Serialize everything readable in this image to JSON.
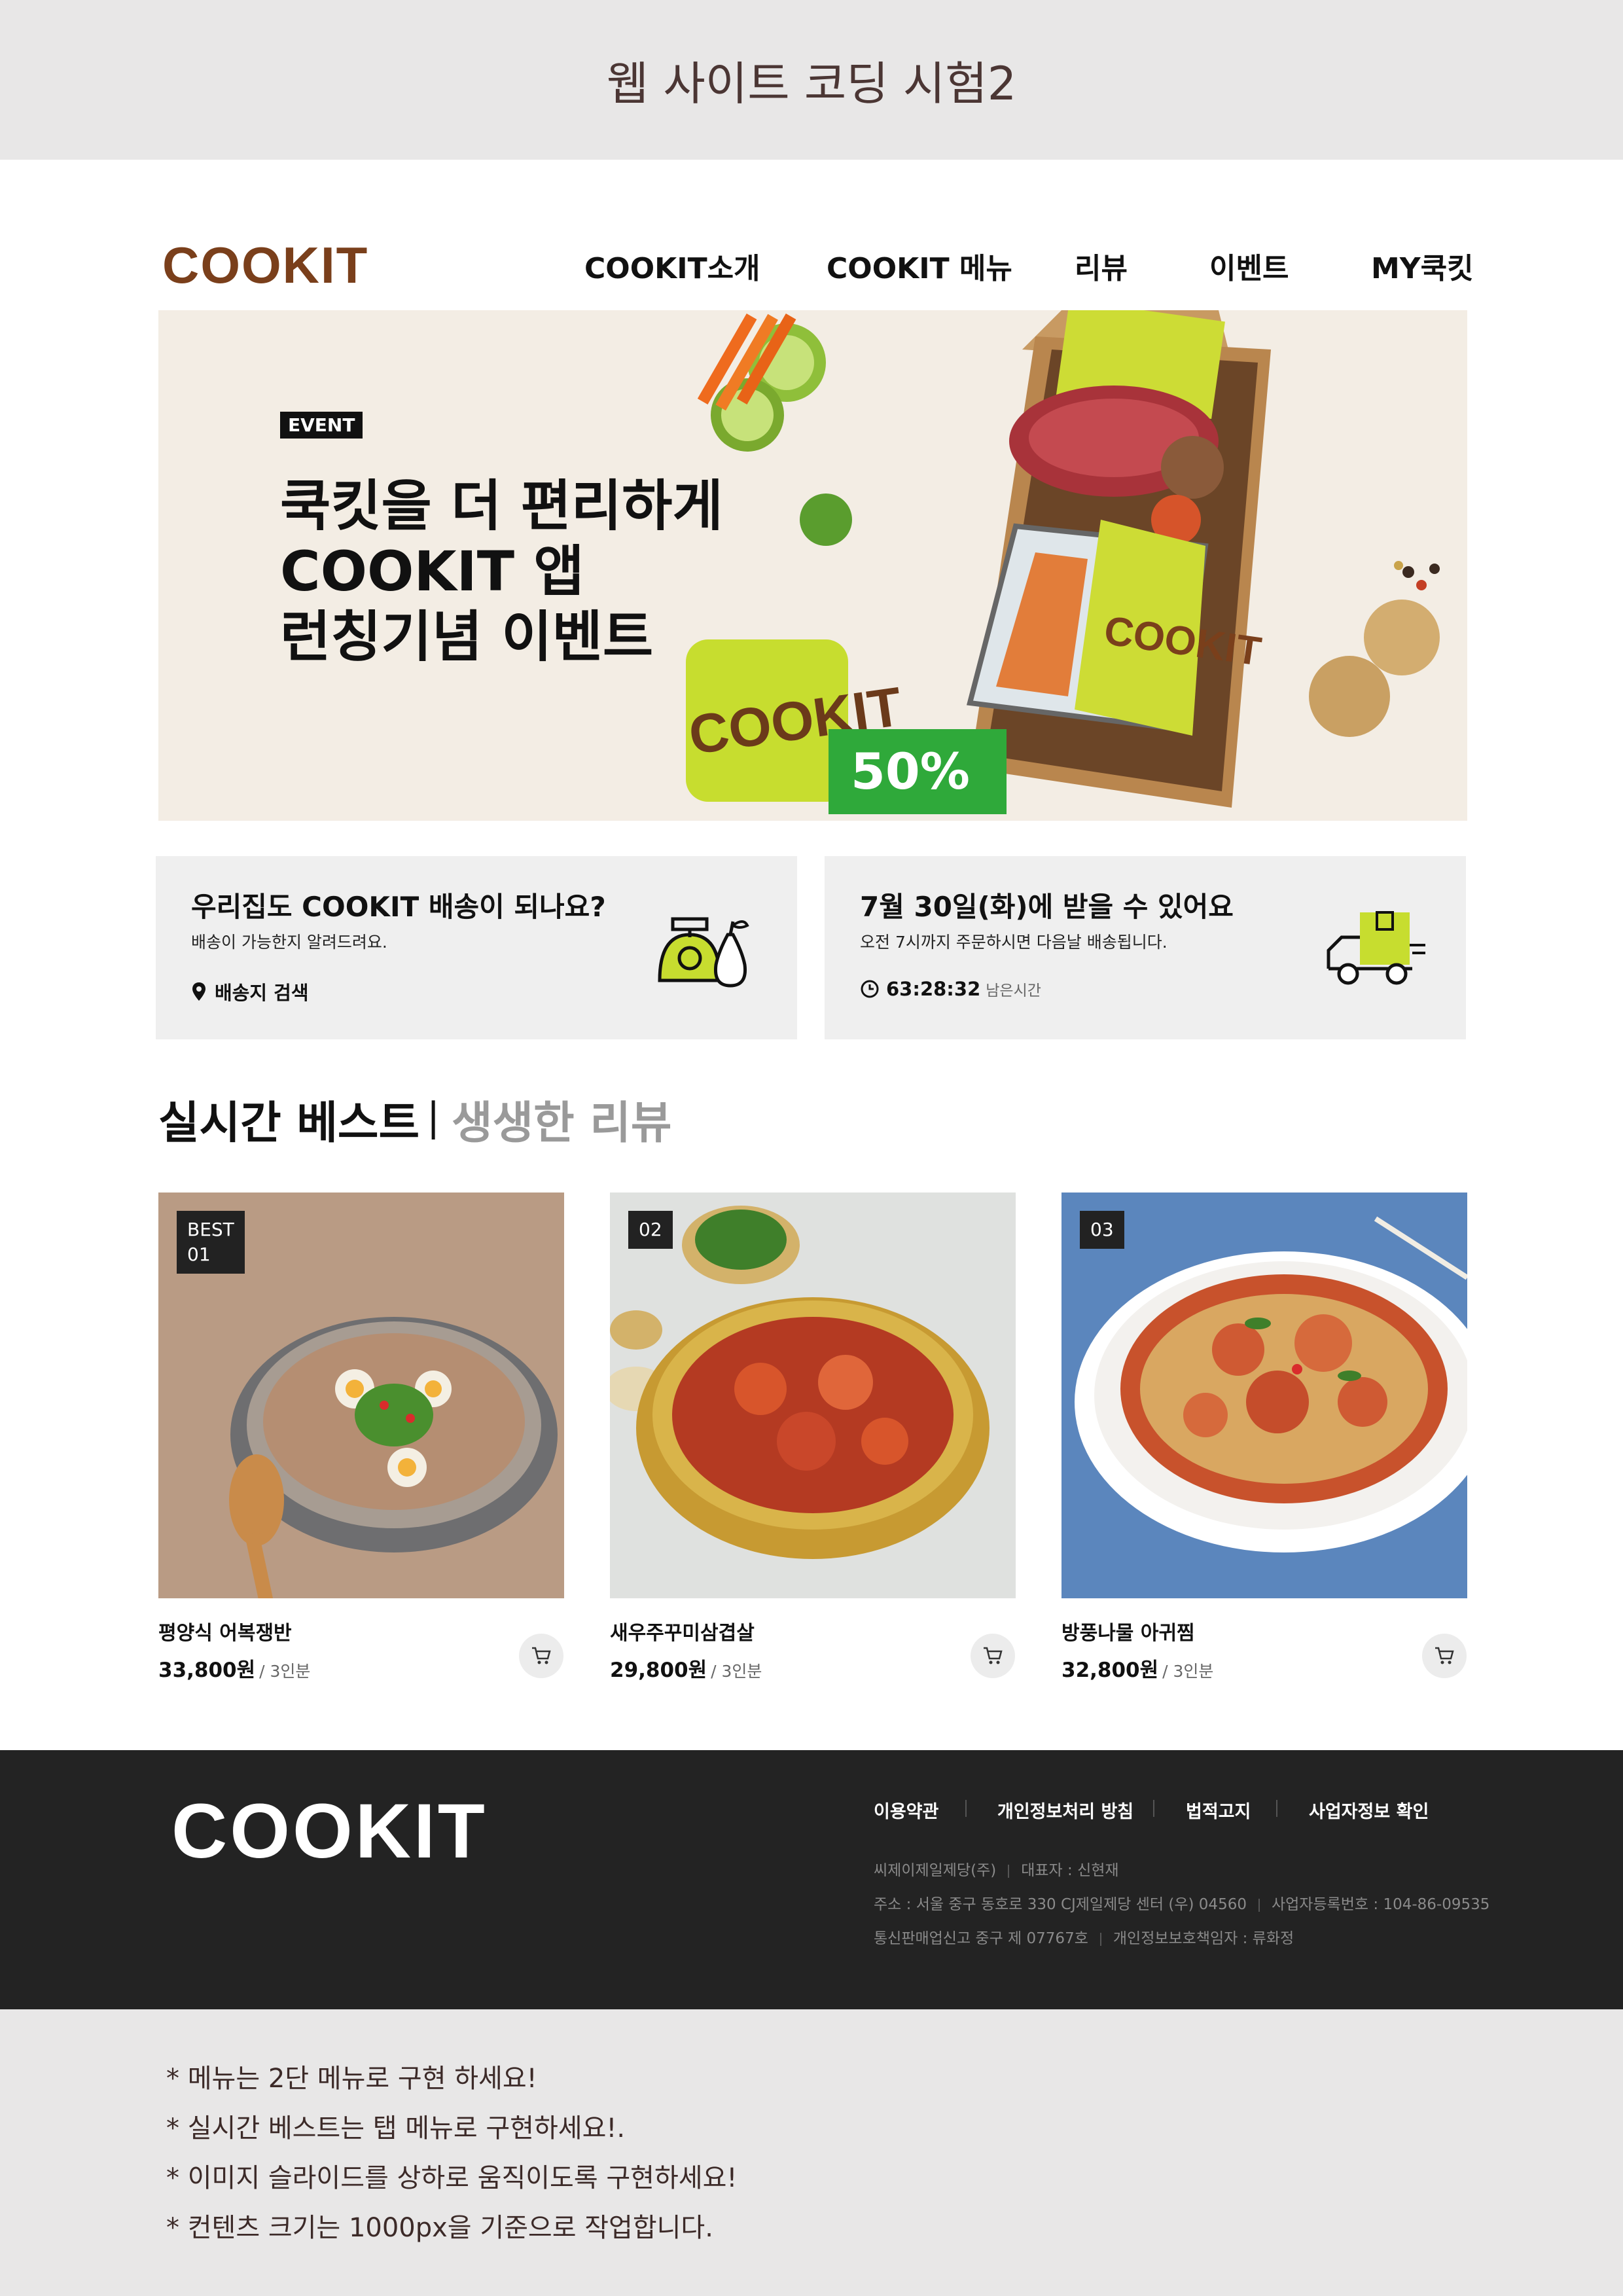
{
  "top_banner": {
    "title": "웹 사이트 코딩 시험2"
  },
  "header": {
    "logo": "COOKIT",
    "nav": [
      "COOKIT소개",
      "COOKIT 메뉴",
      "리뷰",
      "이벤트",
      "MY쿡킷"
    ]
  },
  "hero": {
    "badge": "EVENT",
    "lines": [
      "쿡킷을 더 편리하게",
      "COOKIT 앱",
      "런칭기념 이벤트"
    ],
    "app_logo": "COOKIT",
    "discount": "50%",
    "box_label": "COOKIT"
  },
  "info_cards": [
    {
      "title": "우리집도 COOKIT 배송이 되나요?",
      "subtitle": "배송이 가능한지 알려드려요.",
      "action": "배송지 검색"
    },
    {
      "title": "7월 30일(화)에 받을 수 있어요",
      "subtitle": "오전 7시까지 주문하시면 다음날 배송됩니다.",
      "timer": "63:28:32",
      "timer_label": "남은시간"
    }
  ],
  "best_section": {
    "tab_active": "실시간 베스트",
    "separator": "|",
    "tab_inactive": "생생한 리뷰",
    "products": [
      {
        "badge_line1": "BEST",
        "badge_line2": "01",
        "name": "평양식 어복쟁반",
        "price": "33,800원",
        "unit": "/ 3인분"
      },
      {
        "badge_line1": "02",
        "badge_line2": "",
        "name": "새우주꾸미삼겹살",
        "price": "29,800원",
        "unit": "/ 3인분"
      },
      {
        "badge_line1": "03",
        "badge_line2": "",
        "name": "방풍나물 아귀찜",
        "price": "32,800원",
        "unit": "/ 3인분"
      }
    ]
  },
  "footer": {
    "logo": "COOKIT",
    "links": [
      "이용약관",
      "개인정보처리 방침",
      "법적고지",
      "사업자정보 확인"
    ],
    "company": "씨제이제일제당(주)",
    "ceo": "대표자 : 신현재",
    "address": "주소 : 서울 중구 동호로 330 CJ제일제당 센터 (우) 04560",
    "biz_no": "사업자등록번호 : 104-86-09535",
    "mail_order": "통신판매업신고 중구 제 07767호",
    "privacy_officer": "개인정보보호책임자 : 류화정"
  },
  "notes": [
    "* 메뉴는 2단 메뉴로 구현 하세요!",
    "* 실시간 베스트는 탭 메뉴로 구현하세요!.",
    "* 이미지 슬라이드를 상하로 움직이도록 구현하세요!",
    "* 컨텐츠 크기는 1000px을 기준으로 작업합니다."
  ],
  "colors": {
    "brand": "#7a3f1b",
    "lime": "#c9dd2b",
    "green": "#2fa93a",
    "footer_bg": "#232323",
    "banner_bg": "#e8e7e7"
  }
}
